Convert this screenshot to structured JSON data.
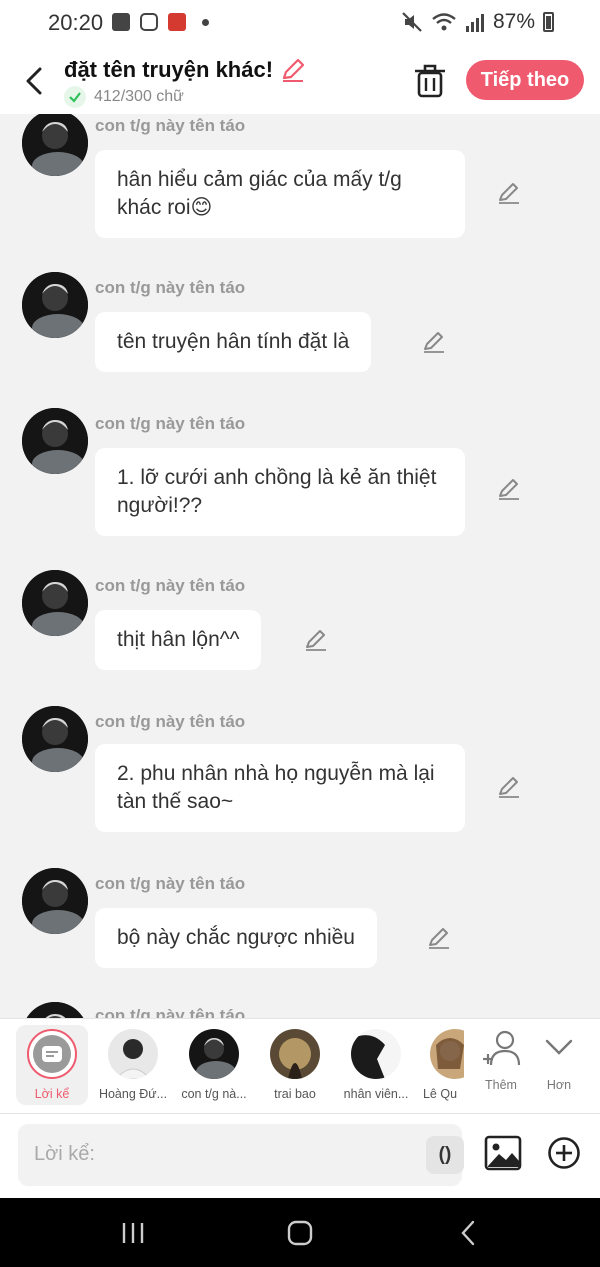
{
  "status_bar": {
    "time": "20:20",
    "battery": "87%"
  },
  "header": {
    "title": "đặt tên truyện khác!",
    "word_count": "412/300 chữ",
    "next_label": "Tiếp theo"
  },
  "messages": [
    {
      "author": "con t/g này tên táo",
      "text": "hân hiểu cảm giác của mấy t/g khác roi😊"
    },
    {
      "author": "con t/g này tên táo",
      "text": "tên truyện hân tính đặt là"
    },
    {
      "author": "con t/g này tên táo",
      "text": "1. lỡ cưới anh chồng là kẻ ăn thiệt người!??"
    },
    {
      "author": "con t/g này tên táo",
      "text": "thịt hân lộn^^"
    },
    {
      "author": "con t/g này tên táo",
      "text": "2. phu nhân nhà họ nguyễn mà lại tàn thế sao~"
    },
    {
      "author": "con t/g này tên táo",
      "text": "bộ này chắc ngược nhiều"
    },
    {
      "author": "con t/g này tên táo",
      "text": ""
    }
  ],
  "characters": {
    "narrator": "Lời kể",
    "items": [
      "Hoàng Đứ...",
      "con t/g nà...",
      "trai bao",
      "nhân viên...",
      "Lê Qu"
    ],
    "add_label": "Thêm",
    "more_label": "Hơn"
  },
  "input": {
    "placeholder": "Lời kể:",
    "paren": "()"
  },
  "colors": {
    "accent": "#f05a6e",
    "background": "#f2f2f2"
  }
}
